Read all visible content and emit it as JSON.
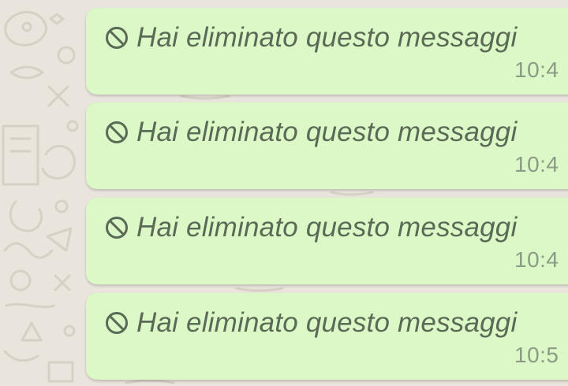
{
  "chat": {
    "messages": [
      {
        "icon": "blocked-icon",
        "text": "Hai eliminato questo messaggi",
        "time": "10:4"
      },
      {
        "icon": "blocked-icon",
        "text": "Hai eliminato questo messaggi",
        "time": "10:4"
      },
      {
        "icon": "blocked-icon",
        "text": "Hai eliminato questo messaggi",
        "time": "10:4"
      },
      {
        "icon": "blocked-icon",
        "text": "Hai eliminato questo messaggi",
        "time": "10:5"
      }
    ]
  },
  "colors": {
    "wallpaper": "#e9e4dc",
    "bubble": "#dcf8c6",
    "text": "#5b6a56",
    "time": "#8c9a86"
  }
}
